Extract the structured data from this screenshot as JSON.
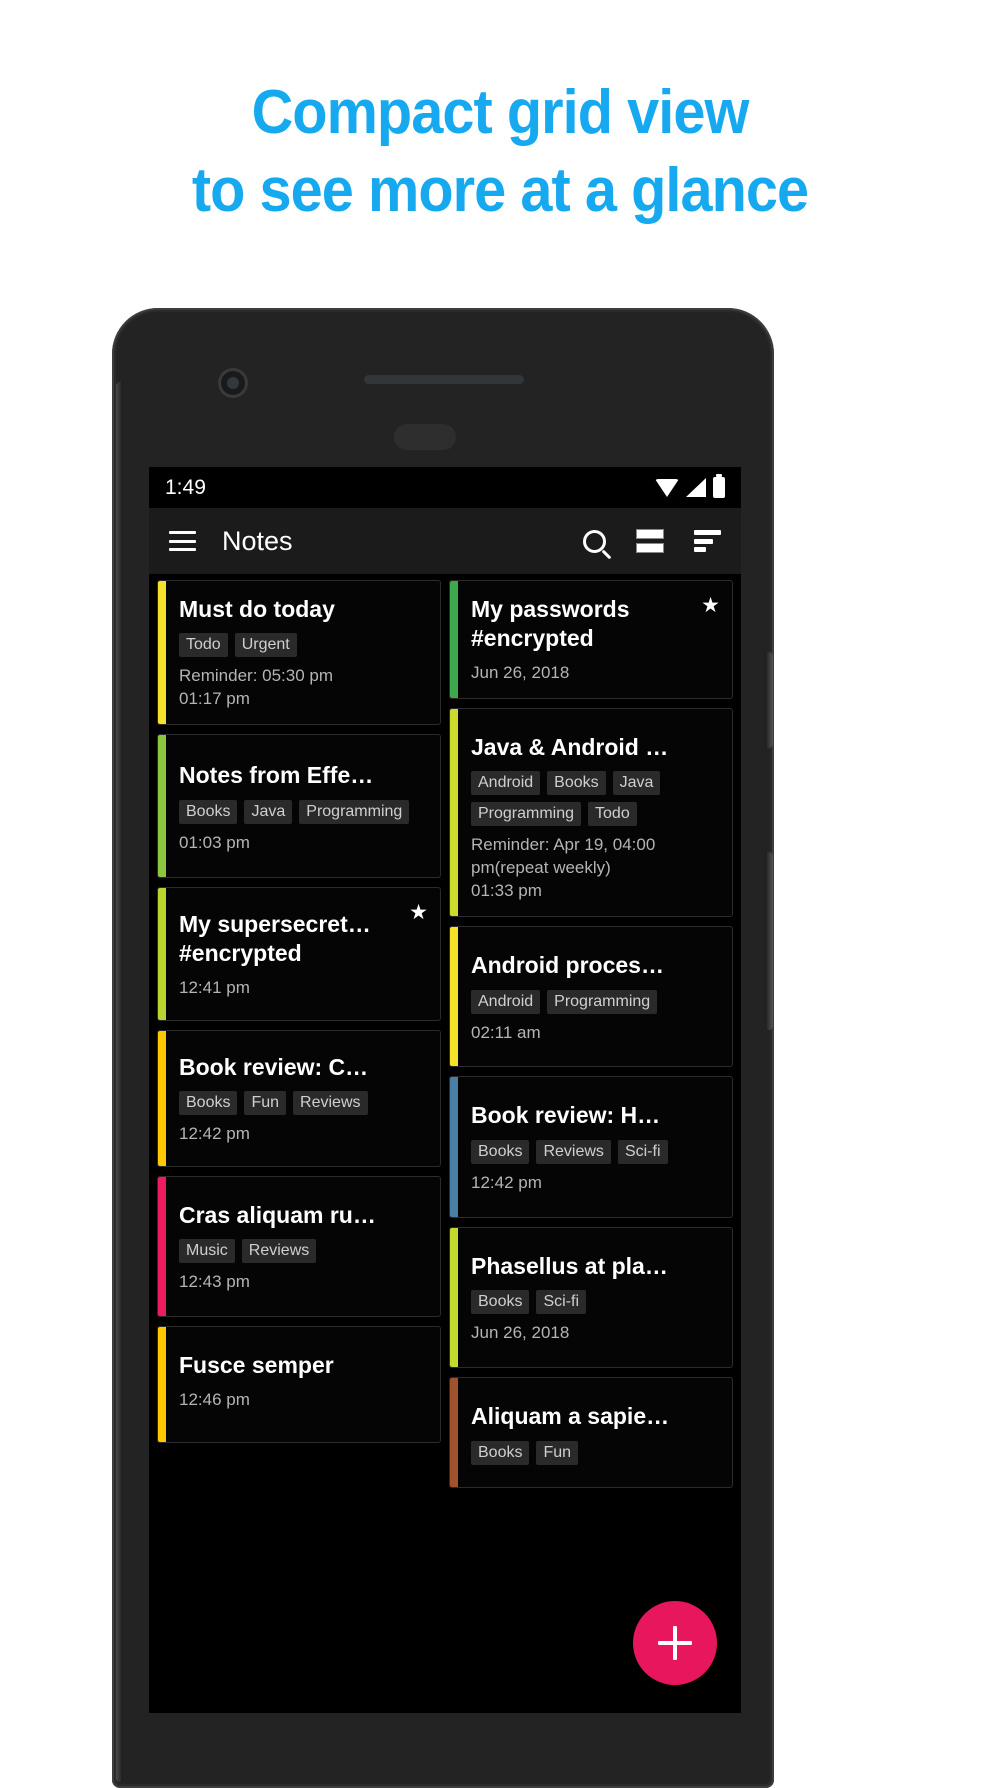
{
  "banner": {
    "line1": "Compact grid view",
    "line2": "to see more at a glance",
    "accent_color": "#17A9F0"
  },
  "status_bar": {
    "time": "1:49",
    "icons": [
      "wifi-icon",
      "cellular-signal-icon",
      "battery-icon"
    ]
  },
  "toolbar": {
    "menu_icon": "hamburger-menu-icon",
    "title": "Notes",
    "search_icon": "search-icon",
    "view_toggle_icon": "grid-view-icon",
    "sort_icon": "sort-icon"
  },
  "fab": {
    "label": "+",
    "color": "#E8175D",
    "icon": "add-note-icon"
  },
  "nav_bar": {
    "back": "back-icon",
    "home": "home-icon",
    "recents": "recents-icon"
  },
  "notes": {
    "left_column": [
      {
        "title": "Must do today",
        "accent": "#F5E02A",
        "tags": [
          "Todo",
          "Urgent"
        ],
        "meta": "Reminder: 05:30 pm",
        "meta_sub": "01:17 pm",
        "starred": false
      },
      {
        "title": "Notes from Effe…",
        "accent": "#8CC63E",
        "tags": [
          "Books",
          "Java",
          "Programming"
        ],
        "meta": "01:03 pm",
        "meta_sub": "",
        "starred": false
      },
      {
        "title": "My supersecret…",
        "title2": "#encrypted",
        "accent": "#B8D430",
        "tags": [],
        "meta": "12:41 pm",
        "meta_sub": "",
        "starred": true,
        "star": "★"
      },
      {
        "title": "Book review: C…",
        "accent": "#FDC800",
        "tags": [
          "Books",
          "Fun",
          "Reviews"
        ],
        "meta": "12:42 pm",
        "meta_sub": "",
        "starred": false
      },
      {
        "title": "Cras aliquam ru…",
        "accent": "#EC1C5E",
        "tags": [
          "Music",
          "Reviews"
        ],
        "meta": "12:43 pm",
        "meta_sub": "",
        "starred": false
      },
      {
        "title": "Fusce semper",
        "accent": "#FDC800",
        "tags": [],
        "meta": "12:46 pm",
        "meta_sub": "",
        "starred": false
      }
    ],
    "right_column": [
      {
        "title": "My passwords",
        "title2": "#encrypted",
        "accent": "#3BA94C",
        "tags": [],
        "meta": "Jun 26, 2018",
        "meta_sub": "",
        "starred": true,
        "star": "★"
      },
      {
        "title": "Java & Android …",
        "accent": "#CBDB2A",
        "tags": [
          "Android",
          "Books",
          "Java",
          "Programming",
          "Todo"
        ],
        "meta": "Reminder: Apr 19, 04:00 pm(repeat weekly)",
        "meta_sub": "01:33 pm",
        "starred": false
      },
      {
        "title": "Android proces…",
        "accent": "#F5E02A",
        "tags": [
          "Android",
          "Programming"
        ],
        "meta": "02:11 am",
        "meta_sub": "",
        "starred": false
      },
      {
        "title": "Book review: H…",
        "accent": "#4A7FA5",
        "tags": [
          "Books",
          "Reviews",
          "Sci-fi"
        ],
        "meta": "12:42 pm",
        "meta_sub": "",
        "starred": false
      },
      {
        "title": "Phasellus at pla…",
        "accent": "#C3D92E",
        "tags": [
          "Books",
          "Sci-fi"
        ],
        "meta": "Jun 26, 2018",
        "meta_sub": "",
        "starred": false
      },
      {
        "title": "Aliquam a sapie…",
        "accent": "#A0522D",
        "tags": [
          "Books",
          "Fun"
        ],
        "meta": "",
        "meta_sub": "",
        "starred": false
      }
    ]
  }
}
